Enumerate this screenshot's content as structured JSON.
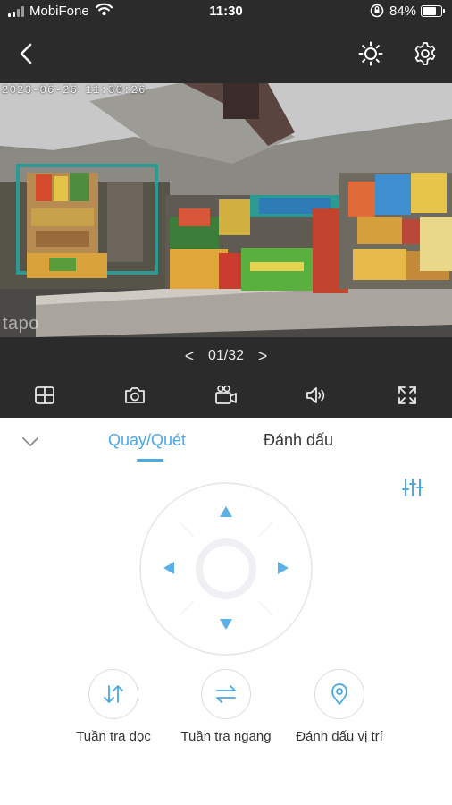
{
  "status_bar": {
    "carrier": "MobiFone",
    "time": "11:30",
    "battery": "84%",
    "battery_level": 0.84
  },
  "nav": {
    "back_icon": "chevron-left-icon",
    "brightness_icon": "sun-icon",
    "settings_icon": "gear-icon"
  },
  "camera": {
    "timestamp": "2023-06-26 11:30:26",
    "watermark": "tapo"
  },
  "pager": {
    "prev": "<",
    "page": "01/32",
    "next": ">"
  },
  "toolbar": {
    "icons": [
      "grid-icon",
      "camera-icon",
      "video-record-icon",
      "speaker-icon",
      "fullscreen-icon"
    ]
  },
  "tabs": {
    "items": [
      "Quay/Quét",
      "Đánh dấu"
    ],
    "active": "Quay/Quét",
    "accent": "#4aa8e3"
  },
  "actions": [
    {
      "label": "Tuần tra dọc",
      "icon": "vertical-arrows-icon"
    },
    {
      "label": "Tuần tra ngang",
      "icon": "horizontal-arrows-icon"
    },
    {
      "label": "Đánh dấu vị trí",
      "icon": "location-pin-icon"
    }
  ]
}
